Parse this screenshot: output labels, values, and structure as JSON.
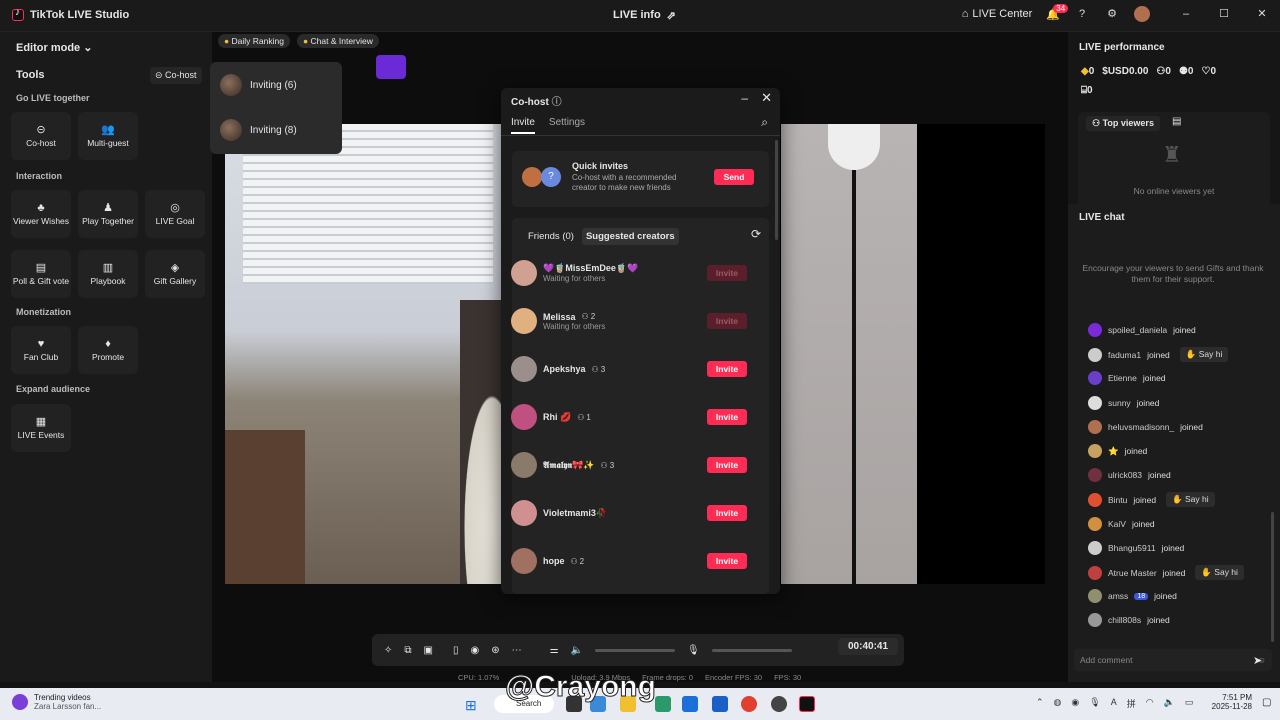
{
  "titlebar": {
    "app": "TikTok LIVE Studio",
    "center": "LIVE info",
    "live_center": "LIVE Center",
    "notif_count": "34"
  },
  "left": {
    "editor": "Editor mode",
    "tools": "Tools",
    "cohost_chip": "Co-host",
    "sections": [
      {
        "title": "Go LIVE together",
        "items": [
          {
            "label": "Co-host",
            "icon": "link-icon"
          },
          {
            "label": "Multi-guest",
            "icon": "people-icon"
          }
        ]
      },
      {
        "title": "Interaction",
        "items": [
          {
            "label": "Viewer Wishes",
            "icon": "wish-icon"
          },
          {
            "label": "Play Together",
            "icon": "play-icon"
          },
          {
            "label": "LIVE Goal",
            "icon": "goal-icon"
          },
          {
            "label": "Poll & Gift vote",
            "icon": "poll-icon"
          },
          {
            "label": "Playbook",
            "icon": "book-icon"
          },
          {
            "label": "Gift Gallery",
            "icon": "gift-icon"
          }
        ]
      },
      {
        "title": "Monetization",
        "items": [
          {
            "label": "Fan Club",
            "icon": "heart-icon"
          },
          {
            "label": "Promote",
            "icon": "flame-icon"
          }
        ]
      },
      {
        "title": "Expand audience",
        "items": [
          {
            "label": "LIVE Events",
            "icon": "calendar-icon"
          }
        ]
      }
    ]
  },
  "stage": {
    "pill1": "Daily Ranking",
    "pill2": "Chat & Interview",
    "inviting": [
      "Inviting (6)",
      "Inviting (8)"
    ]
  },
  "modal": {
    "title": "Co-host",
    "tabs": [
      "Invite",
      "Settings"
    ],
    "quick_title": "Quick invites",
    "quick_desc": "Co-host with a recommended creator to make new friends",
    "send": "Send",
    "friends": "Friends (0)",
    "suggested": "Suggested creators",
    "creators": [
      {
        "name": "💜🧋MissEmDee🧋💜",
        "sub": "Waiting for others",
        "count": "",
        "btn": "Invite",
        "disabled": true
      },
      {
        "name": "Melissa",
        "sub": "Waiting for others",
        "count": "2",
        "btn": "Invite",
        "disabled": true
      },
      {
        "name": "Apekshya",
        "sub": "",
        "count": "3",
        "btn": "Invite",
        "disabled": false
      },
      {
        "name": "Rhi 💋",
        "sub": "",
        "count": "1",
        "btn": "Invite",
        "disabled": false
      },
      {
        "name": "𝕬𝖒𝖆𝖑𝖞𝖓🎀✨",
        "sub": "",
        "count": "3",
        "btn": "Invite",
        "disabled": false
      },
      {
        "name": "Violetmami3🥀",
        "sub": "",
        "count": "",
        "btn": "Invite",
        "disabled": false
      },
      {
        "name": "hope",
        "sub": "",
        "count": "2",
        "btn": "Invite",
        "disabled": false
      }
    ]
  },
  "right": {
    "title": "LIVE performance",
    "stats": [
      "0",
      "USD0.00",
      "0",
      "0",
      "0",
      "0"
    ],
    "top_viewers": "Top viewers",
    "no_viewers": "No online viewers yet",
    "chat_title": "LIVE chat",
    "encourage": "Encourage your viewers to send Gifts and thank them for their support.",
    "chat": [
      {
        "user": "spoiled_daniela",
        "text": "joined",
        "sayhi": false,
        "color": "#7a2ad6"
      },
      {
        "user": "faduma1",
        "text": "joined",
        "sayhi": true,
        "color": "#ccc"
      },
      {
        "user": "Etienne",
        "text": "joined",
        "sayhi": false,
        "color": "#6a3fc8"
      },
      {
        "user": "sunny",
        "text": "joined",
        "sayhi": false,
        "color": "#ddd"
      },
      {
        "user": "heluvsmadisonn_",
        "text": "joined",
        "sayhi": false,
        "color": "#b07050"
      },
      {
        "user": "⭐",
        "text": "joined",
        "sayhi": false,
        "color": "#c8a060"
      },
      {
        "user": "ulrick083",
        "text": "joined",
        "sayhi": false,
        "color": "#703040"
      },
      {
        "user": "Bintu",
        "text": "joined",
        "sayhi": true,
        "color": "#e05030"
      },
      {
        "user": "KaiV",
        "text": "joined",
        "sayhi": false,
        "color": "#d09040"
      },
      {
        "user": "Bhangu5911",
        "text": "joined",
        "sayhi": false,
        "color": "#ccc"
      },
      {
        "user": "Atrue Master",
        "text": "joined",
        "sayhi": true,
        "color": "#c04040"
      },
      {
        "user": "amss",
        "badge": "18",
        "text": "joined",
        "sayhi": false,
        "color": "#909070"
      },
      {
        "user": "chill808s",
        "text": "joined",
        "sayhi": false,
        "color": "#999"
      }
    ],
    "sayhi": "Say hi",
    "comment_placeholder": "Add comment"
  },
  "controls": {
    "timer": "00:40:41",
    "cpu": "CPU: 1.07%",
    "upload": "Upload: 3.9 Mbps",
    "frame_drops": "Frame drops: 0",
    "encoder": "Encoder FPS: 30",
    "fps": "FPS: 30"
  },
  "taskbar": {
    "trend_title": "Trending videos",
    "trend_sub": "Zara Larsson fan...",
    "time": "7:51 PM",
    "date": "2025-11-28",
    "search": "Search"
  },
  "watermark": "@Crayong"
}
